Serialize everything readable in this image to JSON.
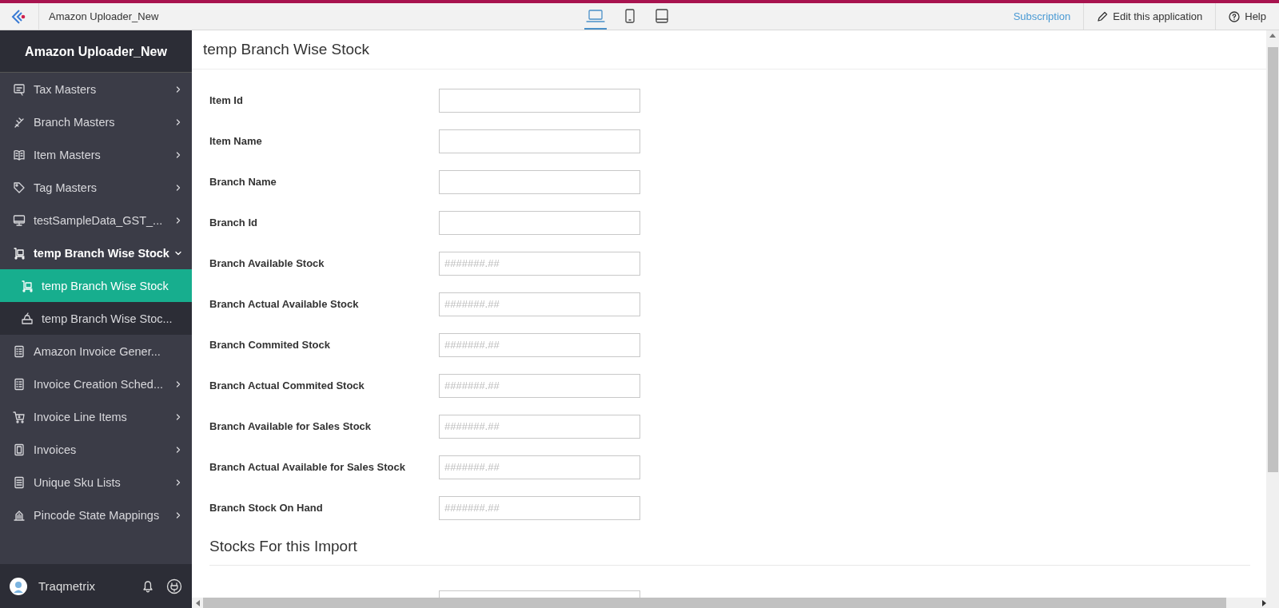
{
  "topbar": {
    "app_name": "Amazon Uploader_New",
    "devices": [
      {
        "selected": true
      },
      {
        "selected": false
      },
      {
        "selected": false
      }
    ],
    "links": [
      {
        "kind": "link",
        "label": "Subscription"
      },
      {
        "kind": "edit",
        "label": "Edit this application"
      },
      {
        "kind": "help",
        "label": "Help"
      }
    ]
  },
  "sidebar": {
    "title": "Amazon Uploader_New",
    "items": [
      {
        "label": "Tax Masters",
        "kind": "folder",
        "expanded": false,
        "selected": false
      },
      {
        "label": "Branch Masters",
        "kind": "folder",
        "expanded": false,
        "selected": false
      },
      {
        "label": "Item Masters",
        "kind": "folder",
        "expanded": false,
        "selected": false
      },
      {
        "label": "Tag Masters",
        "kind": "folder",
        "expanded": false,
        "selected": false
      },
      {
        "label": "testSampleData_GST_...",
        "kind": "folder",
        "expanded": false,
        "selected": false
      },
      {
        "label": "temp Branch Wise Stock",
        "kind": "folder",
        "expanded": true,
        "selected": false,
        "children": [
          {
            "label": "temp Branch Wise Stock",
            "selected": true
          },
          {
            "label": "temp Branch Wise Stoc...",
            "selected": false
          }
        ]
      },
      {
        "label": "Amazon Invoice Gener...",
        "kind": "page",
        "expanded": false,
        "selected": false
      },
      {
        "label": "Invoice Creation Sched...",
        "kind": "folder",
        "expanded": false,
        "selected": false
      },
      {
        "label": "Invoice Line Items",
        "kind": "folder",
        "expanded": false,
        "selected": false
      },
      {
        "label": "Invoices",
        "kind": "folder",
        "expanded": false,
        "selected": false
      },
      {
        "label": "Unique Sku Lists",
        "kind": "folder",
        "expanded": false,
        "selected": false
      },
      {
        "label": "Pincode State Mappings",
        "kind": "folder",
        "expanded": false,
        "selected": false
      }
    ],
    "user": {
      "name": "Traqmetrix"
    }
  },
  "form": {
    "title": "temp Branch Wise Stock",
    "fields": [
      {
        "kind": "text",
        "label": "Item Id"
      },
      {
        "kind": "text",
        "label": "Item Name"
      },
      {
        "kind": "text",
        "label": "Branch Name"
      },
      {
        "kind": "text",
        "label": "Branch Id"
      },
      {
        "kind": "text",
        "label": "Branch Available Stock",
        "placeholder": "#######.##"
      },
      {
        "kind": "text",
        "label": "Branch Actual Available Stock",
        "placeholder": "#######.##"
      },
      {
        "kind": "text",
        "label": "Branch Commited Stock",
        "placeholder": "#######.##"
      },
      {
        "kind": "text",
        "label": "Branch Actual Commited Stock",
        "placeholder": "#######.##"
      },
      {
        "kind": "text",
        "label": "Branch Available for Sales Stock",
        "placeholder": "#######.##"
      },
      {
        "kind": "text",
        "label": "Branch Actual Available for Sales Stock",
        "placeholder": "#######.##"
      },
      {
        "kind": "text",
        "label": "Branch Stock On Hand",
        "placeholder": "#######.##"
      }
    ],
    "sections": [
      {
        "title": "Stocks For this Import",
        "fields": [
          {
            "kind": "text"
          }
        ]
      }
    ]
  }
}
